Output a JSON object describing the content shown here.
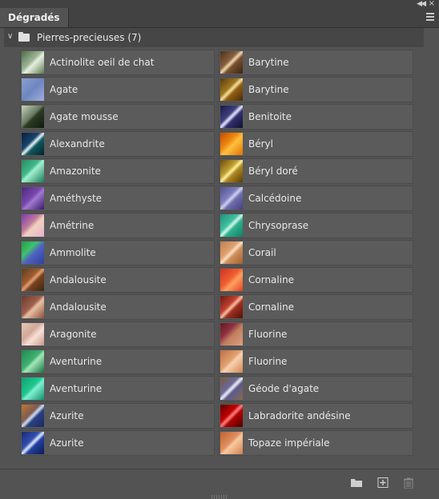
{
  "panel": {
    "tab_label": "Dégradés"
  },
  "group": {
    "title": "Pierres-precieuses (7)"
  },
  "left_items": [
    {
      "label": "Actinolite oeil de chat",
      "gradient": "linear-gradient(135deg,#4d6b47 0%,#9fb89a 45%,#e8f0e0 55%,#5c7a52 100%)"
    },
    {
      "label": "Agate",
      "gradient": "linear-gradient(135deg,#8a9fd0 0%,#6f86c2 50%,#9fb0dc 100%)"
    },
    {
      "label": "Agate mousse",
      "gradient": "linear-gradient(135deg,#c8d4c0 0%,#6b7a62 45%,#2a3a24 55%,#0f1a0c 100%)"
    },
    {
      "label": "Alexandrite",
      "gradient": "linear-gradient(135deg,#0b1d3a 0%,#17466e 40%,#e8f0f4 50%,#0f5a60 60%,#05202c 100%)"
    },
    {
      "label": "Amazonite",
      "gradient": "linear-gradient(135deg,#2a8a62 0%,#3fb88a 40%,#9ff0d0 50%,#1f7a56 100%)"
    },
    {
      "label": "Améthyste",
      "gradient": "linear-gradient(135deg,#4c2a7a 0%,#7a48b0 45%,#a078d0 55%,#3a1a6a 100%)"
    },
    {
      "label": "Amétrine",
      "gradient": "linear-gradient(135deg,#7a3ab0 0%,#c07a9a 40%,#f0d0c0 55%,#e8b0d0 100%)"
    },
    {
      "label": "Ammolite",
      "gradient": "linear-gradient(135deg,#20a040 0%,#40c070 35%,#5060c0 55%,#3040a0 100%)"
    },
    {
      "label": "Andalousite",
      "gradient": "linear-gradient(135deg,#5a4020 0%,#a05a30 40%,#e0a070 50%,#7a4020 60%,#3a2a10 100%)"
    },
    {
      "label": "Andalousite",
      "gradient": "linear-gradient(135deg,#6a3a2a 0%,#a06050 45%,#e8c0a0 55%,#8a5040 100%)"
    },
    {
      "label": "Aragonite",
      "gradient": "linear-gradient(135deg,#e8c8b8 0%,#d0a898 40%,#f8e0d8 60%,#c89888 100%)"
    },
    {
      "label": "Aventurine",
      "gradient": "linear-gradient(135deg,#208a50 0%,#40b070 45%,#a0e8b8 55%,#1a7040 100%)"
    },
    {
      "label": "Aventurine",
      "gradient": "linear-gradient(135deg,#10a070 0%,#20c890 45%,#80f0d0 55%,#10906a 100%)"
    },
    {
      "label": "Azurite",
      "gradient": "linear-gradient(135deg,#c07830 0%,#805a50 40%,#d0e0f0 50%,#2a4080 60%,#1a2a60 100%)"
    },
    {
      "label": "Azurite",
      "gradient": "linear-gradient(135deg,#1a2a70 0%,#3050b0 40%,#e0e8ff 50%,#2040a0 60%,#101a50 100%)"
    }
  ],
  "right_items": [
    {
      "label": "Barytine",
      "gradient": "linear-gradient(135deg,#4a3018 0%,#8a6040 40%,#f0d8b0 50%,#7a5030 60%,#3a2410 100%)"
    },
    {
      "label": "Barytine",
      "gradient": "linear-gradient(135deg,#5a3a10 0%,#a07820 40%,#f8e0a0 50%,#906010 60%,#4a2a08 100%)"
    },
    {
      "label": "Benitoite",
      "gradient": "linear-gradient(135deg,#1a1a40 0%,#404080 40%,#e8e8ff 50%,#303070 60%,#101030 100%)"
    },
    {
      "label": "Béryl",
      "gradient": "linear-gradient(135deg,#c04a00 0%,#f08a10 40%,#ffc040 55%,#e07000 100%)"
    },
    {
      "label": "Béryl doré",
      "gradient": "linear-gradient(135deg,#6a4a10 0%,#c0a030 40%,#fff0a0 50%,#b08a20 60%,#5a3a08 100%)"
    },
    {
      "label": "Calcédoine",
      "gradient": "linear-gradient(135deg,#50508a 0%,#8080c0 40%,#d0d0f0 50%,#7070b0 60%,#404080 100%)"
    },
    {
      "label": "Chrysoprase",
      "gradient": "linear-gradient(135deg,#20907a 0%,#40c0a0 40%,#d0f8e8 50%,#30b090 60%,#108060 100%)"
    },
    {
      "label": "Corail",
      "gradient": "linear-gradient(135deg,#c08050 0%,#e0a070 40%,#f8e0c0 50%,#d09060 60%,#a06030 100%)"
    },
    {
      "label": "Cornaline",
      "gradient": "linear-gradient(135deg,#d03020 0%,#f06030 45%,#ffa060 60%,#e04020 100%)"
    },
    {
      "label": "Cornaline",
      "gradient": "linear-gradient(135deg,#6a1a10 0%,#c04030 40%,#f8c0a0 50%,#a03020 60%,#501008 100%)"
    },
    {
      "label": "Fluorine",
      "gradient": "linear-gradient(135deg,#601a20 0%,#903040 35%,#c08060 55%,#e0a080 100%)"
    },
    {
      "label": "Fluorine",
      "gradient": "linear-gradient(135deg,#c07040 0%,#e0a070 45%,#f8d0b0 55%,#d08850 100%)"
    },
    {
      "label": "Géode d'agate",
      "gradient": "linear-gradient(135deg,#7a5a40 0%,#6a6a9a 40%,#f0f0f8 50%,#5a5a8a 60%,#8a6a50 100%)"
    },
    {
      "label": "Labradorite andésine",
      "gradient": "linear-gradient(135deg,#600000 0%,#c00000 40%,#ff8080 50%,#b00000 60%,#500000 100%)"
    },
    {
      "label": "Topaze impériale",
      "gradient": "linear-gradient(135deg,#c06030 0%,#e09060 45%,#f8c8a0 55%,#d08050 100%)"
    }
  ],
  "icons": {
    "collapse": "double-chevron-left-icon",
    "menu": "hamburger-menu-icon",
    "new_group": "folder-icon",
    "new_gradient": "add-icon",
    "delete": "trash-icon"
  }
}
